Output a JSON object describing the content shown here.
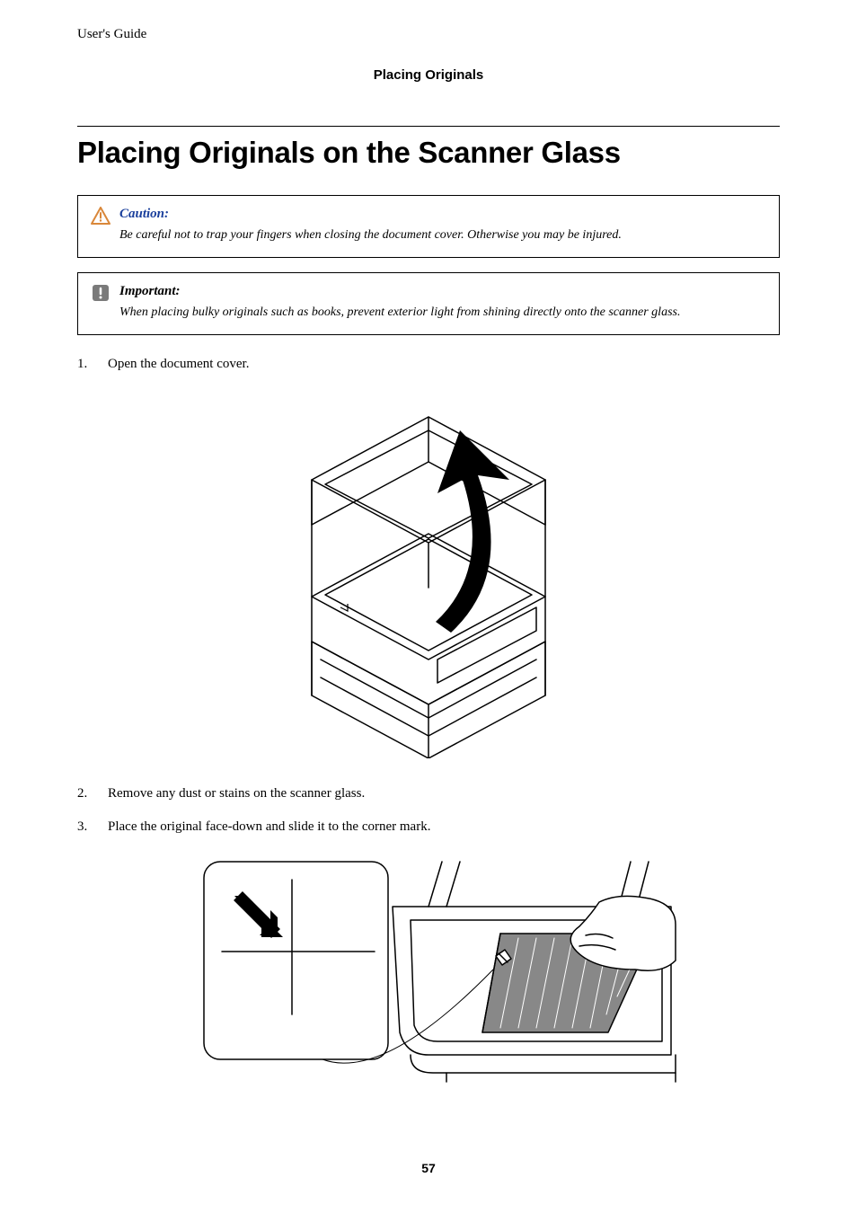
{
  "header": {
    "guide": "User's Guide",
    "section": "Placing Originals"
  },
  "title": "Placing Originals on the Scanner Glass",
  "notices": {
    "caution": {
      "label": "Caution:",
      "text": "Be careful not to trap your fingers when closing the document cover. Otherwise you may be injured."
    },
    "important": {
      "label": "Important:",
      "text": "When placing bulky originals such as books, prevent exterior light from shining directly onto the scanner glass."
    }
  },
  "steps": [
    "Open the document cover.",
    "Remove any dust or stains on the scanner glass.",
    "Place the original face-down and slide it to the corner mark."
  ],
  "pageNumber": "57"
}
